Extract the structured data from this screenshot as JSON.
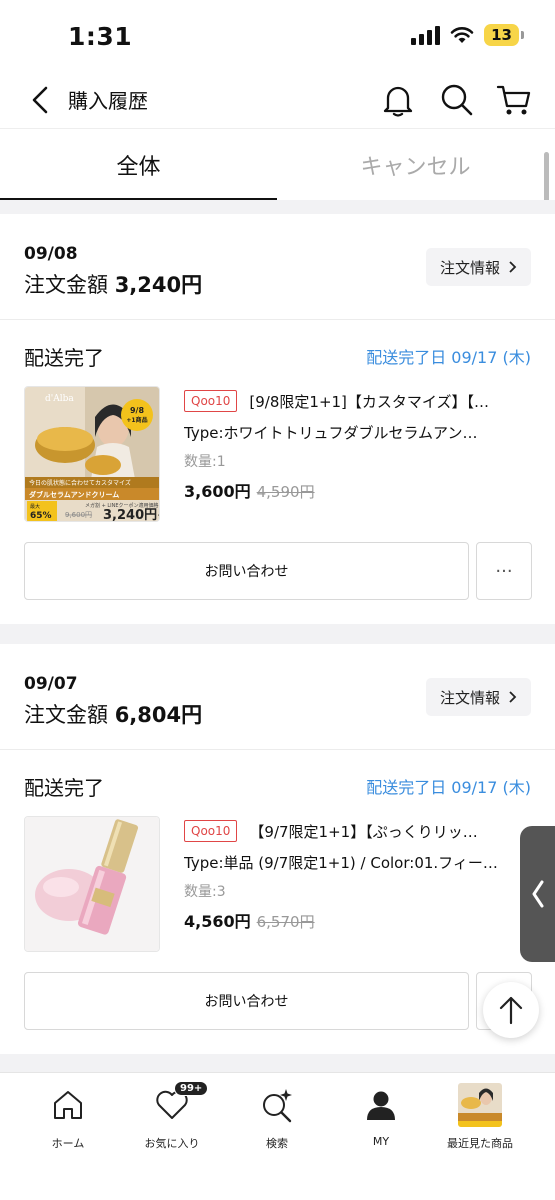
{
  "status_bar": {
    "time": "1:31",
    "battery": "13"
  },
  "header": {
    "title": "購入履歴"
  },
  "tabs": [
    {
      "label": "全体",
      "active": true
    },
    {
      "label": "キャンセル",
      "active": false
    }
  ],
  "orders": [
    {
      "date": "09/08",
      "amount_label": "注文金額",
      "amount": "3,240円",
      "info_button": "注文情報",
      "delivery_status": "配送完了",
      "delivery_date": "配送完了日 09/17 (木)",
      "product": {
        "shop": "Qoo10",
        "name": "[9/8限定1+1]【カスタマイズ】【…",
        "type": "Type:ホワイトトリュフダブルセラムアン…",
        "qty": "数量:1",
        "price": "3,600円",
        "original_price": "4,590円",
        "image": {
          "brand": "d'Alba",
          "badge": "9/8\n+1商品",
          "promo_line1": "今日の肌状態に合わせてカスタマイズ",
          "promo_line2": "ダブルセラムアンドクリーム",
          "discount_label": "最大",
          "discount": "65%",
          "old_price": "9,600円",
          "new_price": "3,240円~",
          "note": "メガ割 + LINEクーポン適用価格"
        }
      },
      "inquiry_button": "お問い合わせ",
      "more_button": "···"
    },
    {
      "date": "09/07",
      "amount_label": "注文金額",
      "amount": "6,804円",
      "info_button": "注文情報",
      "delivery_status": "配送完了",
      "delivery_date": "配送完了日 09/17 (木)",
      "product": {
        "shop": "Qoo10",
        "name": "【9/7限定1+1】【ぷっくりリッ…",
        "type": "Type:単品 (9/7限定1+1) / Color:01.フィー…",
        "qty": "数量:3",
        "price": "4,560円",
        "original_price": "6,570円"
      },
      "inquiry_button": "お問い合わせ"
    }
  ],
  "bottom_nav": [
    {
      "label": "ホーム",
      "icon": "home-icon"
    },
    {
      "label": "お気に入り",
      "icon": "heart-icon",
      "badge": "99+"
    },
    {
      "label": "検索",
      "icon": "search-sparkle-icon"
    },
    {
      "label": "MY",
      "icon": "person-icon"
    },
    {
      "label": "最近見た商品",
      "icon": "recent-product-thumbnail"
    }
  ],
  "colors": {
    "accent_blue": "#3a8dde",
    "shop_red": "#e04646",
    "battery_yellow": "#f7d548"
  }
}
